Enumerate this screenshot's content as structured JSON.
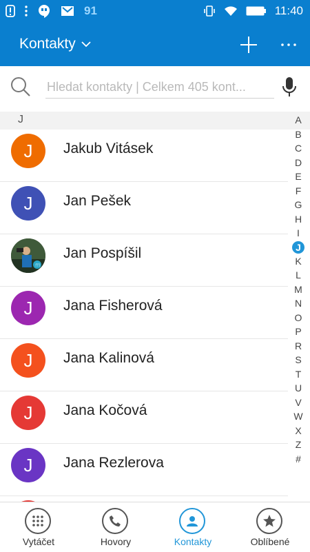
{
  "status_bar": {
    "notification_count": "91",
    "time": "11:40"
  },
  "header": {
    "title": "Kontakty"
  },
  "search": {
    "placeholder": "Hledat kontakty | Celkem 405 kont..."
  },
  "section_letter": "J",
  "contacts": [
    {
      "name": "Jakub Vitásek",
      "initial": "J",
      "color": "#ef6c00"
    },
    {
      "name": "Jan Pešek",
      "initial": "J",
      "color": "#3f51b5"
    },
    {
      "name": "Jan Pospíšil",
      "initial": "",
      "color": "#2b3a2a"
    },
    {
      "name": "Jana Fisherová",
      "initial": "J",
      "color": "#9c27b0"
    },
    {
      "name": "Jana Kalinová",
      "initial": "J",
      "color": "#f4511e"
    },
    {
      "name": "Jana Kočová",
      "initial": "J",
      "color": "#e53935"
    },
    {
      "name": "Jana Rezlerova",
      "initial": "J",
      "color": "#6a35c4"
    },
    {
      "name": "",
      "initial": "",
      "color": "#e53935"
    }
  ],
  "alphabet": [
    "A",
    "B",
    "C",
    "D",
    "E",
    "F",
    "G",
    "H",
    "I",
    "J",
    "K",
    "L",
    "M",
    "N",
    "O",
    "P",
    "R",
    "S",
    "T",
    "U",
    "V",
    "W",
    "X",
    "Z",
    "#"
  ],
  "alphabet_active": "J",
  "nav": {
    "dialer": "Vytáčet",
    "calls": "Hovory",
    "contacts": "Kontakty",
    "favorites": "Oblíbené",
    "active": "contacts"
  },
  "colors": {
    "primary": "#0a7fcf",
    "accent": "#2196d8"
  }
}
